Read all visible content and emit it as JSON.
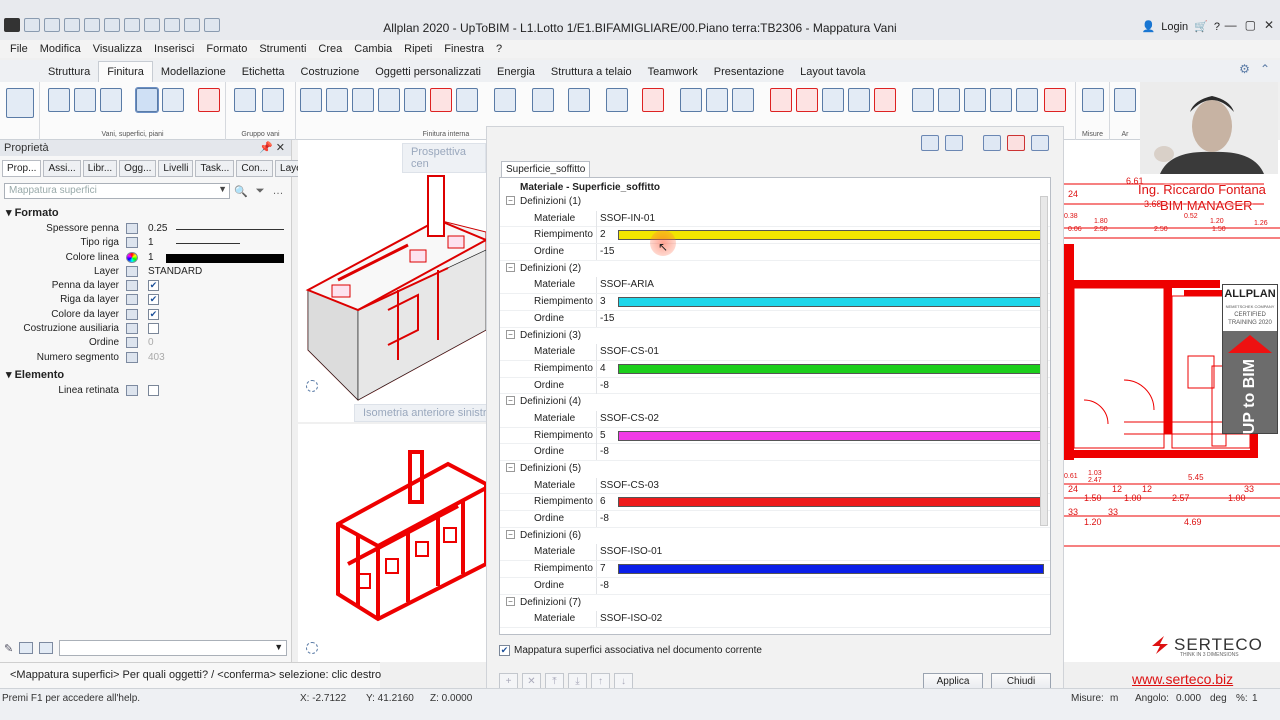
{
  "app": {
    "title": "Allplan 2020 - UpToBIM - L1.Lotto 1/E1.BIFAMIGLIARE/00.Piano terra:TB2306 - Mappatura Vani",
    "login": "Login",
    "help": "?",
    "window_buttons": [
      "—",
      "▢",
      "✕"
    ]
  },
  "menu": [
    "File",
    "Modifica",
    "Visualizza",
    "Inserisci",
    "Formato",
    "Strumenti",
    "Crea",
    "Cambia",
    "Ripeti",
    "Finestra",
    "?"
  ],
  "ribbon": {
    "tabs": [
      "Struttura",
      "Finitura",
      "Modellazione",
      "Etichetta",
      "Costruzione",
      "Oggetti personalizzati",
      "Energia",
      "Struttura a telaio",
      "Teamwork",
      "Presentazione",
      "Layout tavola"
    ],
    "active_tab": "Finitura",
    "groups": [
      "Vani, superfici, piani",
      "Gruppo vani",
      "Finitura interna",
      "Misure",
      "Ar"
    ]
  },
  "properties": {
    "title": "Proprietà",
    "tabs": [
      "Prop...",
      "Assi...",
      "Libr...",
      "Ogg...",
      "Livelli",
      "Task...",
      "Con...",
      "Layer"
    ],
    "filter_placeholder": "Mappatura superfici",
    "sections": {
      "formato": "Formato",
      "elemento": "Elemento"
    },
    "rows": {
      "spessore_label": "Spessore penna",
      "spessore_value": "0.25",
      "tipo_label": "Tipo riga",
      "tipo_value": "1",
      "colore_label": "Colore linea",
      "colore_value": "1",
      "layer_label": "Layer",
      "layer_value": "STANDARD",
      "penna_label": "Penna da layer",
      "riga_label": "Riga da layer",
      "colore_layer_label": "Colore da layer",
      "costruzione_label": "Costruzione ausiliaria",
      "ordine_label": "Ordine",
      "ordine_value": "0",
      "numero_label": "Numero segmento",
      "numero_value": "403",
      "linea_label": "Linea retinata"
    }
  },
  "viewports": {
    "top_label": "Prospettiva cen",
    "bottom_label": "Isometria anteriore sinistr"
  },
  "dialog": {
    "tab": "Superficie_soffitto",
    "header": "Materiale - Superficie_soffitto",
    "material_label": "Materiale",
    "fill_label": "Riempimento",
    "order_label": "Ordine",
    "definitions": [
      {
        "title": "Definizioni (1)",
        "material": "SSOF-IN-01",
        "fill": "2",
        "color": "#f2e500",
        "order": "-15"
      },
      {
        "title": "Definizioni (2)",
        "material": "SSOF-ARIA",
        "fill": "3",
        "color": "#1ed6ea",
        "order": "-15"
      },
      {
        "title": "Definizioni (3)",
        "material": "SSOF-CS-01",
        "fill": "4",
        "color": "#1ccf1c",
        "order": "-8"
      },
      {
        "title": "Definizioni (4)",
        "material": "SSOF-CS-02",
        "fill": "5",
        "color": "#f03be6",
        "order": "-8"
      },
      {
        "title": "Definizioni (5)",
        "material": "SSOF-CS-03",
        "fill": "6",
        "color": "#ee1b1b",
        "order": "-8"
      },
      {
        "title": "Definizioni (6)",
        "material": "SSOF-ISO-01",
        "fill": "7",
        "color": "#0a1ee8",
        "order": "-8"
      },
      {
        "title": "Definizioni (7)",
        "material": "SSOF-ISO-02"
      }
    ],
    "checkbox_label": "Mappatura superfici associativa nel documento corrente",
    "apply": "Applica",
    "close": "Chiudi"
  },
  "right_view": {
    "dims_top": [
      "6.61",
      "24",
      "3.68",
      "0.38",
      "1.80",
      "0.52",
      "1.20",
      "1.26",
      "0.06",
      "2.50",
      "2.50",
      "1.50"
    ],
    "dims_bottom": [
      "0.61",
      "1.03",
      "2.47",
      "5.45",
      "24",
      "12",
      "12",
      "33",
      "1.50",
      "1.00",
      "2.57",
      "1.00",
      "33",
      "33",
      "1.20",
      "4.69"
    ]
  },
  "overlay": {
    "name": "Ing. Riccardo Fontana",
    "role": "BIM MANAGER",
    "badge_brand": "ALLPLAN",
    "badge_company": "NEMETSCHEK COMPANY",
    "badge_line1": "CERTIFIED",
    "badge_line2": "TRAINING 2020",
    "badge_vertical": "UP to BIM",
    "logo": "SERTECO",
    "logo_tag": "THINK IN 3 DIMENSIONS",
    "url": "www.serteco.biz"
  },
  "command": "<Mappatura superfici> Per quali oggetti? / <conferma> selezione: clic destro",
  "status": {
    "help": "Premi F1 per accedere all'help.",
    "x": "X:   -2.7122",
    "y": "Y:   41.2160",
    "z": "Z:   0.0000",
    "misure": "Misure:",
    "misure_unit": "m",
    "angolo": "Angolo:",
    "angolo_value": "0.000",
    "angolo_unit": "deg",
    "percent": "%:",
    "percent_value": "1"
  },
  "colors": {
    "accent_red": "#dd1111",
    "ribbon_icon": "#5a7ba6"
  }
}
